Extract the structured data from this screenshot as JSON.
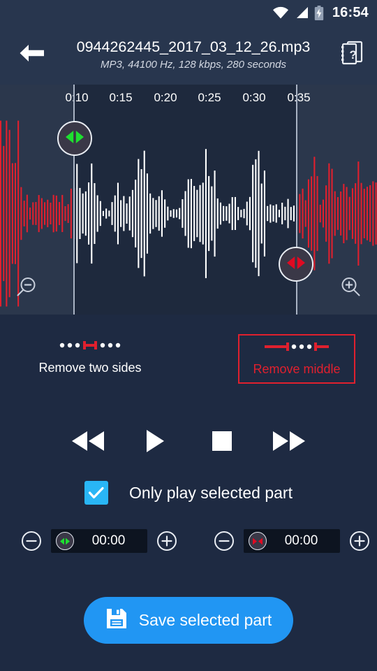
{
  "statusbar": {
    "time": "16:54",
    "icons": [
      "wifi-icon",
      "cellular-signal-icon",
      "battery-charging-icon"
    ]
  },
  "appbar": {
    "back_icon": "back-arrow-icon",
    "title": "0944262445_2017_03_12_26.mp3",
    "subtitle": "MP3, 44100 Hz, 128 kbps, 280 seconds",
    "help_icon": "help-manual-icon"
  },
  "waveform": {
    "ruler_ticks": [
      "0:10",
      "0:15",
      "0:20",
      "0:25",
      "0:30",
      "0:35"
    ],
    "left_handle_icon": "selection-handle-green-icon",
    "right_handle_icon": "selection-handle-red-icon",
    "zoom_out_icon": "zoom-out-icon",
    "zoom_in_icon": "zoom-in-icon",
    "selected_color": "#ffffff",
    "unselected_color": "#e0202e"
  },
  "remove": {
    "two_sides_label": "Remove two sides",
    "two_sides_icon": "remove-two-sides-icon",
    "middle_label": "Remove middle",
    "middle_icon": "remove-middle-icon",
    "selected": "middle",
    "accent_color": "#e0202e"
  },
  "transport": {
    "rewind_icon": "rewind-icon",
    "play_icon": "play-icon",
    "stop_icon": "stop-icon",
    "forward_icon": "fast-forward-icon"
  },
  "checkbox": {
    "label": "Only play selected part",
    "checked": true,
    "color": "#29b6f6"
  },
  "steppers": {
    "start": {
      "minus_icon": "minus-circle-icon",
      "badge_icon": "selection-handle-green-icon",
      "value": "00:00",
      "plus_icon": "plus-circle-icon"
    },
    "end": {
      "minus_icon": "minus-circle-icon",
      "badge_icon": "selection-handle-red-icon",
      "value": "00:00",
      "plus_icon": "plus-circle-icon"
    }
  },
  "save": {
    "label": "Save selected part",
    "icon": "save-floppy-icon",
    "color": "#2196f3"
  }
}
